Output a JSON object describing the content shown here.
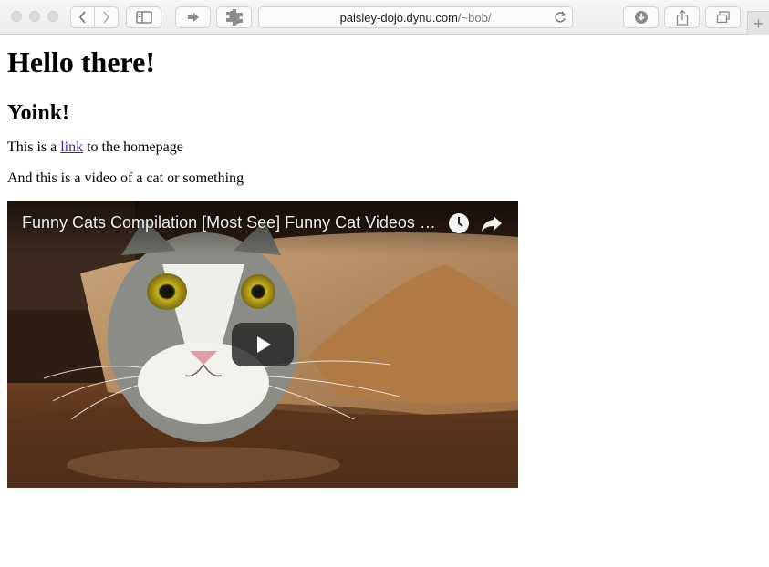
{
  "browser": {
    "url_host": "paisley-dojo.dynu.com",
    "url_path": "/~bob/",
    "new_tab_label": "+"
  },
  "page": {
    "heading": "Hello there!",
    "subheading": "Yoink!",
    "para1_before": "This is a ",
    "para1_link": "link",
    "para1_after": " to the homepage",
    "para2": "And this is a video of a cat or something"
  },
  "video": {
    "title": "Funny Cats Compilation [Most See] Funny Cat Videos Ever Funny Vines",
    "icons": [
      "watch-later-icon",
      "share-icon",
      "play-icon"
    ],
    "colors": {
      "play_button_bg": "#212121",
      "title": "#eeeeee"
    }
  }
}
